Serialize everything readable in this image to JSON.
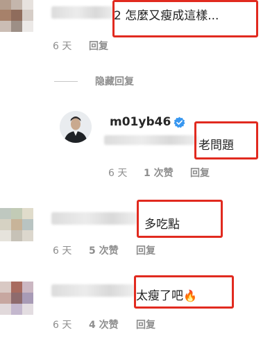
{
  "comments": [
    {
      "text": "2 怎麼又瘦成這樣...",
      "time": "6 天",
      "reply": "回复"
    },
    {
      "text": "多吃點",
      "time": "6 天",
      "likes": "5 次赞",
      "reply": "回复"
    },
    {
      "text": "太瘦了吧",
      "emoji": "🔥",
      "time": "6 天",
      "likes": "4 次赞",
      "reply": "回复"
    }
  ],
  "hide_replies": {
    "label": "隐藏回复"
  },
  "reply": {
    "username": "m01yb46",
    "text": "老問題",
    "time": "6 天",
    "likes": "1 次赞",
    "reply_label": "回复"
  },
  "colors": {
    "highlight_box": "#e12a1f",
    "verified_badge": "#3897f0",
    "meta_text": "#8e8e8e"
  },
  "icons": {
    "verified": "verified-badge-icon",
    "fire": "fire-icon"
  }
}
